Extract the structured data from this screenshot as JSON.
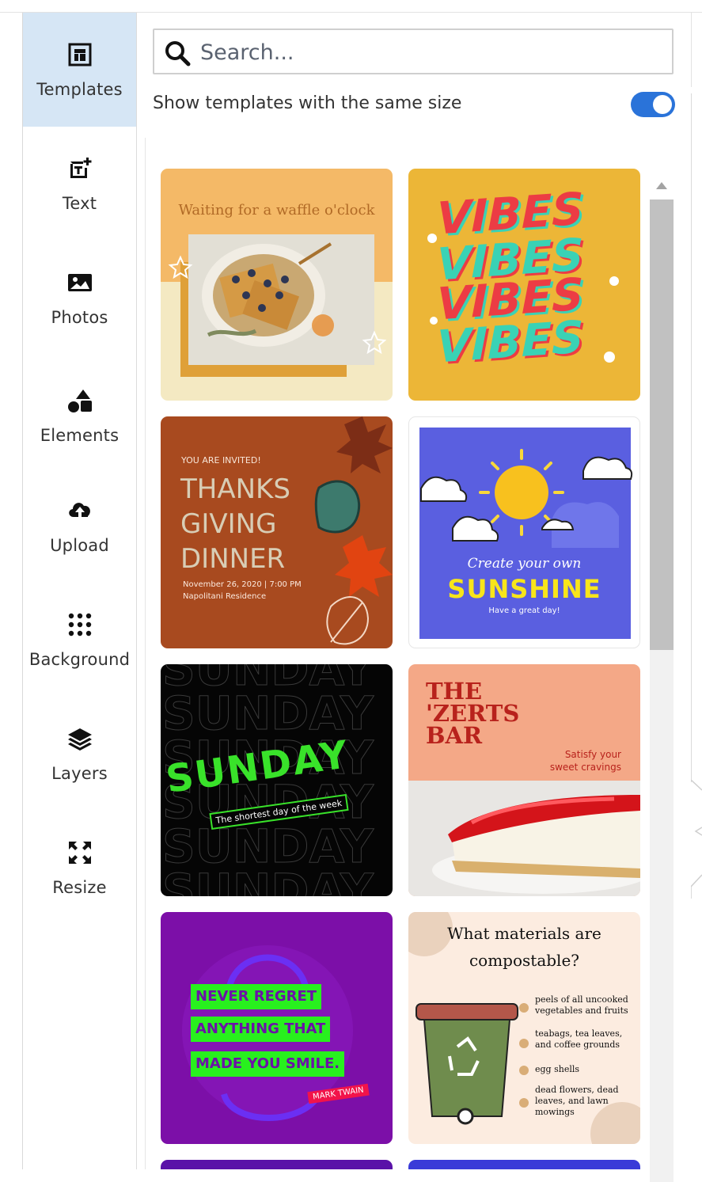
{
  "sidebar": {
    "items": [
      {
        "label": "Templates",
        "icon": "template-icon",
        "active": true
      },
      {
        "label": "Text",
        "icon": "text-icon"
      },
      {
        "label": "Photos",
        "icon": "photo-icon"
      },
      {
        "label": "Elements",
        "icon": "elements-icon"
      },
      {
        "label": "Upload",
        "icon": "upload-icon"
      },
      {
        "label": "Background",
        "icon": "background-icon"
      },
      {
        "label": "Layers",
        "icon": "layers-icon"
      },
      {
        "label": "Resize",
        "icon": "resize-icon"
      }
    ]
  },
  "search": {
    "placeholder": "Search..."
  },
  "toggle": {
    "label": "Show templates with the same size",
    "on": true
  },
  "templates": [
    {
      "title": "Waiting for a waffle o'clock"
    },
    {
      "words": [
        "VIBES",
        "VIBES",
        "VIBES",
        "VIBES"
      ]
    },
    {
      "kicker": "YOU ARE INVITED!",
      "lines": [
        "THANKS",
        "GIVING",
        "DINNER"
      ],
      "date": "November 26, 2020 | 7:00 PM",
      "place": "Napolitani Residence"
    },
    {
      "script": "Create your own",
      "title": "SUNSHINE",
      "sub": "Have a great day!"
    },
    {
      "title": "SUNDAY",
      "sub": "The shortest day of the week",
      "bg": "SUNDAY"
    },
    {
      "title_lines": [
        "THE",
        "'ZERTS",
        "BAR"
      ],
      "tagline": [
        "Satisfy your",
        "sweet cravings"
      ]
    },
    {
      "quote_lines": [
        "NEVER REGRET",
        "ANYTHING THAT",
        "MADE YOU SMILE."
      ],
      "author": "MARK TWAIN"
    },
    {
      "title_lines": [
        "What materials are",
        "compostable?"
      ],
      "items": [
        [
          "peels of all uncooked",
          "vegetables and fruits"
        ],
        [
          "teabags, tea leaves,",
          "and coffee grounds"
        ],
        [
          "egg shells"
        ],
        [
          "dead flowers, dead",
          "leaves, and lawn",
          "mowings"
        ]
      ]
    }
  ],
  "colors": {
    "accent": "#2a73d9",
    "active_bg": "#d6e6f5"
  }
}
